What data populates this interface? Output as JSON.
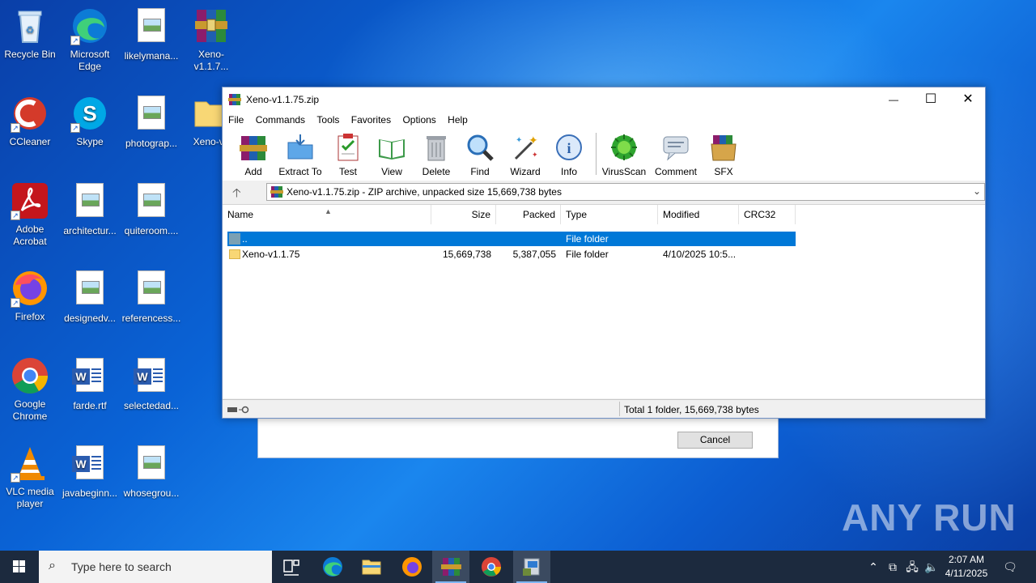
{
  "desktop": {
    "icons": [
      {
        "label": "Recycle Bin"
      },
      {
        "label": "Microsoft Edge"
      },
      {
        "label": "likelymana..."
      },
      {
        "label": "Xeno-v1.1.7..."
      },
      {
        "label": "CCleaner"
      },
      {
        "label": "Skype"
      },
      {
        "label": "photograp..."
      },
      {
        "label": "Xeno-v1"
      },
      {
        "label": "Adobe Acrobat"
      },
      {
        "label": "architectur..."
      },
      {
        "label": "quiteroom...."
      },
      {
        "label": "Firefox"
      },
      {
        "label": "designedv..."
      },
      {
        "label": "referencess..."
      },
      {
        "label": "Google Chrome"
      },
      {
        "label": "farde.rtf"
      },
      {
        "label": "selectedad..."
      },
      {
        "label": "VLC media player"
      },
      {
        "label": "javabeginn..."
      },
      {
        "label": "whosegrou..."
      }
    ]
  },
  "background_dialog": {
    "cancel_label": "Cancel"
  },
  "winrar": {
    "title": "Xeno-v1.1.75.zip",
    "window_buttons": {
      "minimize": "—",
      "maximize": "☐",
      "close": "✕"
    },
    "menu": [
      "File",
      "Commands",
      "Tools",
      "Favorites",
      "Options",
      "Help"
    ],
    "toolbar": [
      {
        "label": "Add",
        "icon": "add-archive-icon"
      },
      {
        "label": "Extract To",
        "icon": "extract-icon"
      },
      {
        "label": "Test",
        "icon": "test-icon"
      },
      {
        "label": "View",
        "icon": "view-book-icon"
      },
      {
        "label": "Delete",
        "icon": "trash-icon"
      },
      {
        "label": "Find",
        "icon": "magnifier-icon"
      },
      {
        "label": "Wizard",
        "icon": "wand-icon"
      },
      {
        "label": "Info",
        "icon": "info-icon"
      },
      {
        "label": "VirusScan",
        "icon": "virus-icon"
      },
      {
        "label": "Comment",
        "icon": "comment-icon"
      },
      {
        "label": "SFX",
        "icon": "sfx-box-icon"
      }
    ],
    "address": "Xeno-v1.1.75.zip - ZIP archive, unpacked size 15,669,738 bytes",
    "columns": [
      "Name",
      "Size",
      "Packed",
      "Type",
      "Modified",
      "CRC32"
    ],
    "rows": [
      {
        "name": "..",
        "size": "",
        "packed": "",
        "type": "File folder",
        "modified": "",
        "crc": "",
        "selected": true
      },
      {
        "name": "Xeno-v1.1.75",
        "size": "15,669,738",
        "packed": "5,387,055",
        "type": "File folder",
        "modified": "4/10/2025 10:5...",
        "crc": "",
        "selected": false
      }
    ],
    "status": "Total 1 folder, 15,669,738 bytes"
  },
  "taskbar": {
    "search_placeholder": "Type here to search",
    "time": "2:07 AM",
    "date": "4/11/2025"
  },
  "watermark": "ANY RUN",
  "colors": {
    "selection": "#0078d7",
    "taskbar": "#1c2a3e"
  }
}
